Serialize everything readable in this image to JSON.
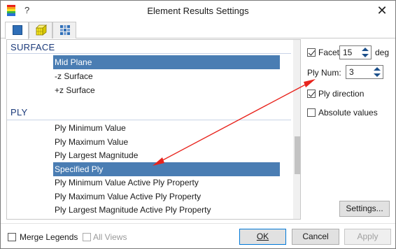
{
  "window": {
    "title": "Element Results Settings",
    "help": "?",
    "close": "✕"
  },
  "tabs": [
    {
      "name": "elements-2d-tab",
      "icon": "blue-square-icon"
    },
    {
      "name": "elements-3d-tab",
      "icon": "yellow-cube-icon"
    },
    {
      "name": "grid-tab",
      "icon": "grid-icon"
    }
  ],
  "list": {
    "surface_header": "SURFACE",
    "surface_items": [
      "Mid Plane",
      "-z Surface",
      "+z Surface"
    ],
    "ply_header": "PLY",
    "ply_items": [
      "Ply Minimum Value",
      "Ply Maximum Value",
      "Ply Largest Magnitude",
      "Specified Ply",
      "Ply Minimum Value Active Ply Property",
      "Ply Maximum Value Active Ply Property",
      "Ply Largest Magnitude Active Ply Property"
    ],
    "selected": [
      "Mid Plane",
      "Specified Ply"
    ]
  },
  "options": {
    "facet_label": "Facet",
    "facet_value": "15",
    "facet_unit": "deg",
    "facet_checked": true,
    "ply_num_label": "Ply Num:",
    "ply_num_value": "3",
    "ply_direction_label": "Ply direction",
    "ply_direction_checked": true,
    "absolute_values_label": "Absolute values",
    "absolute_values_checked": false,
    "settings_button": "Settings..."
  },
  "footer": {
    "merge_legends_label": "Merge Legends",
    "merge_legends_checked": false,
    "all_views_label": "All Views",
    "all_views_checked": false,
    "ok_button": "OK",
    "cancel_button": "Cancel",
    "apply_button": "Apply"
  },
  "colors": {
    "selection": "#4a7db3",
    "header_text": "#1b3a7a",
    "annotation_arrow": "#e8231c"
  }
}
